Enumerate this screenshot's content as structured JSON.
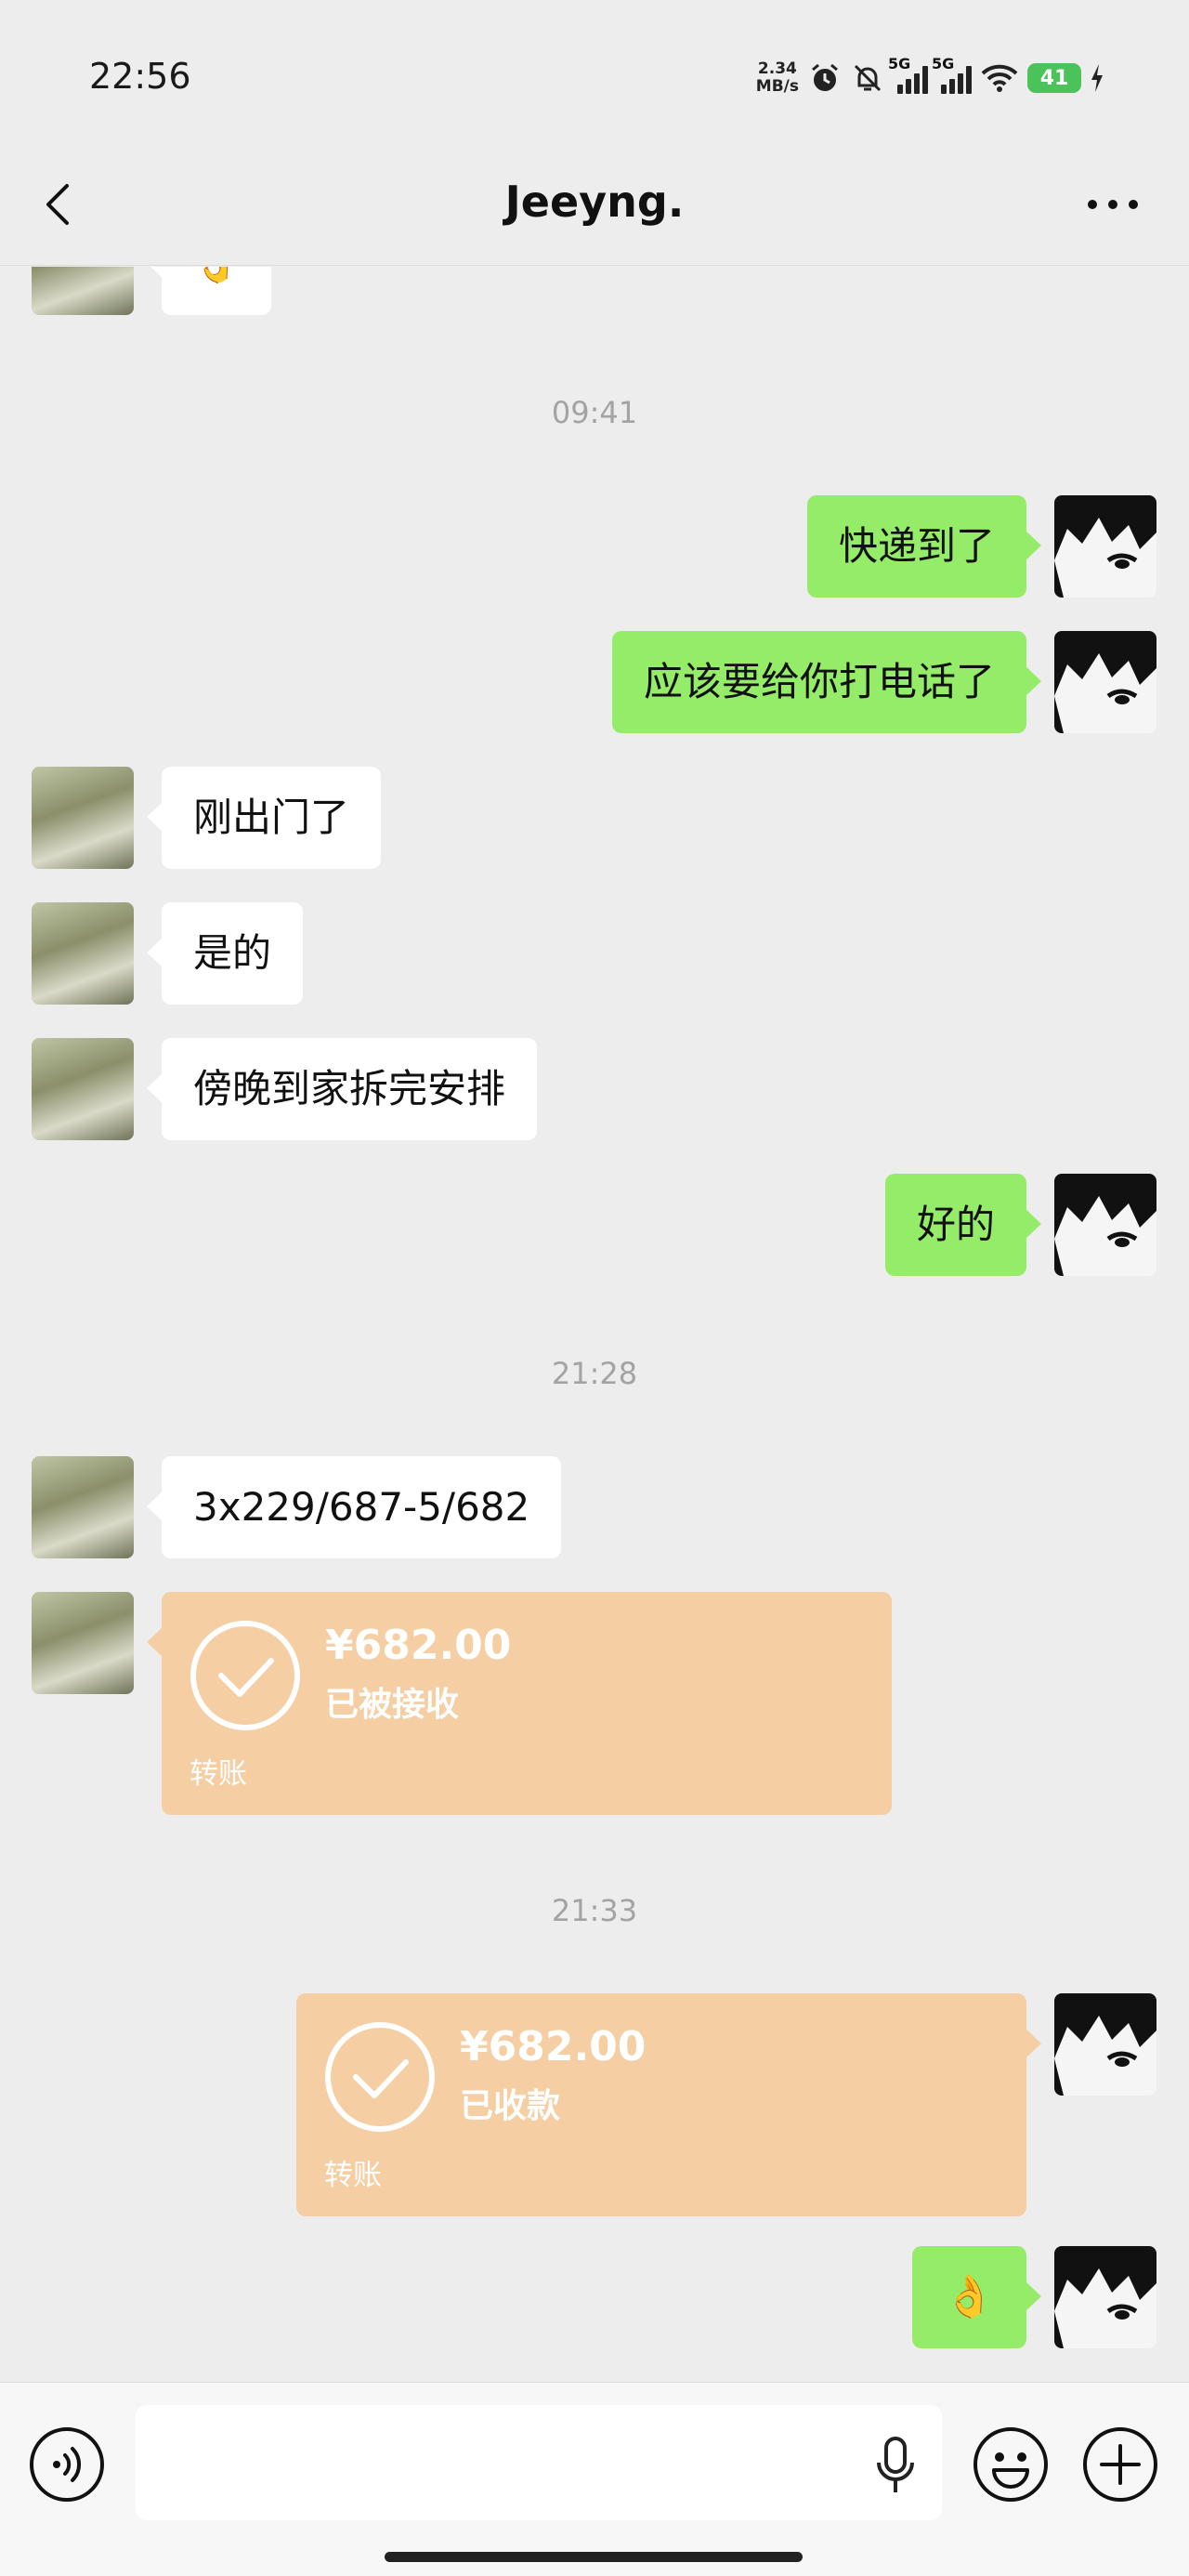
{
  "status_bar": {
    "time": "22:56",
    "net_speed_value": "2.34",
    "net_speed_unit": "MB/s",
    "sim1_label": "5G",
    "sim2_label": "5G",
    "battery": "41",
    "icons": [
      "alarm-icon",
      "silent-bell-icon",
      "signal-icon",
      "signal-icon",
      "wifi-icon",
      "battery-icon",
      "charging-icon"
    ]
  },
  "header": {
    "title": "Jeeyng.",
    "back_icon": "chevron-left-icon",
    "more_icon": "more-dots-icon"
  },
  "messages": [
    {
      "type": "text",
      "from": "them",
      "content": "👌"
    },
    {
      "type": "timestamp",
      "content": "09:41"
    },
    {
      "type": "text",
      "from": "me",
      "content": "快递到了"
    },
    {
      "type": "text",
      "from": "me",
      "content": "应该要给你打电话了"
    },
    {
      "type": "text",
      "from": "them",
      "content": "刚出门了"
    },
    {
      "type": "text",
      "from": "them",
      "content": "是的"
    },
    {
      "type": "text",
      "from": "them",
      "content": "傍晚到家拆完安排"
    },
    {
      "type": "text",
      "from": "me",
      "content": "好的"
    },
    {
      "type": "timestamp",
      "content": "21:28"
    },
    {
      "type": "text",
      "from": "them",
      "content": "3x229/687-5/682"
    },
    {
      "type": "transfer",
      "from": "them",
      "amount": "¥682.00",
      "status": "已被接收",
      "label": "转账"
    },
    {
      "type": "timestamp",
      "content": "21:33"
    },
    {
      "type": "transfer",
      "from": "me",
      "amount": "¥682.00",
      "status": "已收款",
      "label": "转账"
    },
    {
      "type": "text",
      "from": "me",
      "content": "👌"
    }
  ],
  "input_bar": {
    "placeholder": "",
    "icons": [
      "voice-icon",
      "mic-icon",
      "emoji-icon",
      "plus-icon"
    ]
  },
  "colors": {
    "background": "#ededed",
    "outgoing_bubble": "#95ec69",
    "incoming_bubble": "#ffffff",
    "transfer_card": "#f5cfa3"
  }
}
